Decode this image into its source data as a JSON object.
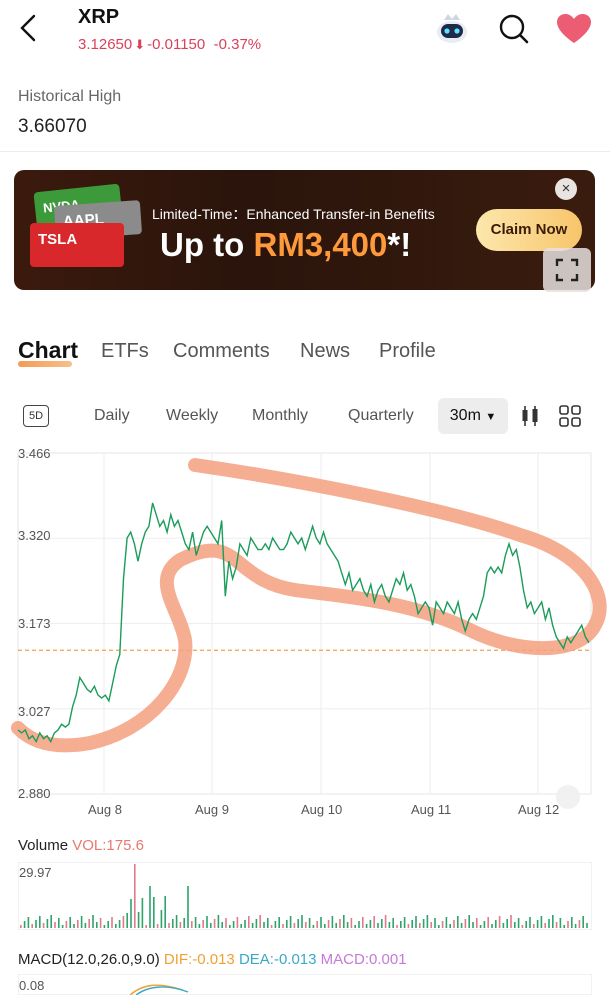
{
  "header": {
    "ticker": "XRP",
    "price": "3.12650",
    "change": "-0.01150",
    "change_pct": "-0.37%",
    "down_color": "#d9415a"
  },
  "historical": {
    "label": "Historical High",
    "value": "3.66070"
  },
  "banner": {
    "cards": [
      "NVDA",
      "AAPL",
      "TSLA"
    ],
    "headline": "Limited-Time：Enhanced Transfer-in Benefits",
    "offer_prefix": "Up to ",
    "offer_amount": "RM3,400",
    "offer_suffix": "*!",
    "cta": "Claim Now",
    "close": "×"
  },
  "tabs": [
    "Chart",
    "ETFs",
    "Comments",
    "News",
    "Profile"
  ],
  "periods": {
    "badge": "5D",
    "items": [
      "Daily",
      "Weekly",
      "Monthly",
      "Quarterly"
    ],
    "selected": "30m",
    "dropdown_icon": "caret-down-icon"
  },
  "chart_data": {
    "type": "line",
    "y_ticks": [
      "3.466",
      "3.320",
      "3.173",
      "3.027",
      "2.880"
    ],
    "x_labels": [
      "Aug 8",
      "Aug 9",
      "Aug 10",
      "Aug 11",
      "Aug 12"
    ],
    "ylim": [
      2.88,
      3.466
    ],
    "reference_line": 3.127,
    "line_color": "#1a9c5a",
    "reference_color": "#f0a050",
    "annotation_color": "#f4a07f",
    "series": [
      {
        "values": [
          2.99,
          2.985,
          2.99,
          2.975,
          2.98,
          2.97,
          2.985,
          2.975,
          2.98,
          2.97,
          2.985,
          2.99,
          3.0,
          2.995,
          3.0,
          3.03,
          3.05,
          3.08,
          3.07,
          3.06,
          3.055,
          3.065,
          3.05,
          3.045,
          3.05,
          3.04,
          3.07,
          3.1,
          3.12,
          3.25,
          3.32,
          3.33,
          3.31,
          3.28,
          3.31,
          3.33,
          3.34,
          3.38,
          3.36,
          3.34,
          3.35,
          3.33,
          3.36,
          3.34,
          3.35,
          3.33,
          3.31,
          3.3,
          3.33,
          3.29,
          3.31,
          3.33,
          3.34,
          3.33,
          3.32,
          3.31,
          3.35,
          3.22,
          3.28,
          3.25,
          3.27,
          3.31,
          3.3,
          3.29,
          3.32,
          3.31,
          3.3,
          3.3,
          3.31,
          3.3,
          3.32,
          3.31,
          3.3,
          3.3,
          3.31,
          3.33,
          3.32,
          3.31,
          3.32,
          3.3,
          3.32,
          3.34,
          3.32,
          3.31,
          3.33,
          3.31,
          3.3,
          3.29,
          3.28,
          3.26,
          3.24,
          3.26,
          3.23,
          3.24,
          3.25,
          3.23,
          3.22,
          3.24,
          3.21,
          3.23,
          3.24,
          3.22,
          3.21,
          3.23,
          3.25,
          3.24,
          3.26,
          3.23,
          3.24,
          3.22,
          3.19,
          3.2,
          3.21,
          3.2,
          3.17,
          3.21,
          3.2,
          3.19,
          3.21,
          3.2,
          3.19,
          3.21,
          3.18,
          3.16,
          3.18,
          3.19,
          3.18,
          3.2,
          3.22,
          3.26,
          3.27,
          3.26,
          3.27,
          3.26,
          3.29,
          3.31,
          3.29,
          3.3,
          3.27,
          3.23,
          3.2,
          3.21,
          3.19,
          3.2,
          3.21,
          3.18,
          3.2,
          3.17,
          3.15,
          3.14,
          3.13,
          3.15,
          3.14,
          3.15,
          3.16,
          3.17,
          3.15,
          3.14
        ]
      }
    ]
  },
  "volume": {
    "label": "Volume",
    "vol_text": "VOL:175.6",
    "max": "29.97"
  },
  "macd": {
    "label": "MACD(12.0,26.0,9.0)",
    "dif": "DIF:-0.013",
    "dea": "DEA:-0.013",
    "macd": "MACD:0.001",
    "max": "0.08",
    "dif_color": "#f0a030",
    "dea_color": "#3aa8c8",
    "macd_color": "#c47ad8"
  }
}
